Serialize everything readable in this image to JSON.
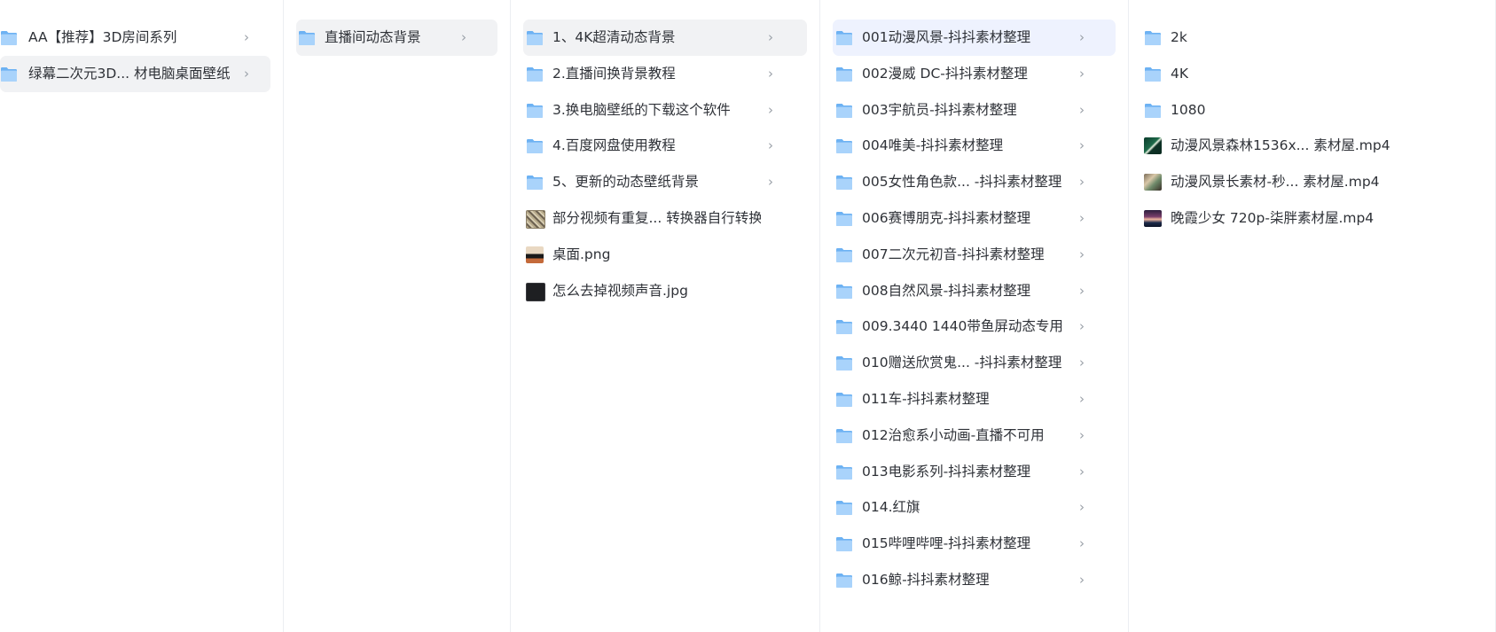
{
  "columns": [
    {
      "items": [
        {
          "label": "AA【推荐】3D房间系列",
          "type": "folder",
          "chevron": "›",
          "state": ""
        },
        {
          "label": "绿幕二次元3D... 材电脑桌面壁纸",
          "type": "folder",
          "chevron": "›",
          "state": "selected"
        }
      ]
    },
    {
      "items": [
        {
          "label": "直播间动态背景",
          "type": "folder",
          "chevron": "›",
          "state": "selected"
        }
      ]
    },
    {
      "items": [
        {
          "label": "1、4K超清动态背景",
          "type": "folder",
          "chevron": "›",
          "state": "selected"
        },
        {
          "label": "2.直播间换背景教程",
          "type": "folder",
          "chevron": "›",
          "state": ""
        },
        {
          "label": "3.换电脑壁纸的下载这个软件",
          "type": "folder",
          "chevron": "›",
          "state": ""
        },
        {
          "label": "4.百度网盘使用教程",
          "type": "folder",
          "chevron": "›",
          "state": ""
        },
        {
          "label": "5、更新的动态壁纸背景",
          "type": "folder",
          "chevron": "›",
          "state": ""
        },
        {
          "label": "部分视频有重复...  转换器自行转换",
          "type": "image",
          "thumb": "mosaic",
          "state": ""
        },
        {
          "label": "桌面.png",
          "type": "image",
          "thumb": "desk",
          "state": ""
        },
        {
          "label": "怎么去掉视频声音.jpg",
          "type": "image",
          "thumb": "dark",
          "state": ""
        }
      ]
    },
    {
      "items": [
        {
          "label": "001动漫风景-抖抖素材整理",
          "type": "folder",
          "chevron": "›",
          "state": "active"
        },
        {
          "label": "002漫威 DC-抖抖素材整理",
          "type": "folder",
          "chevron": "›",
          "state": ""
        },
        {
          "label": "003宇航员-抖抖素材整理",
          "type": "folder",
          "chevron": "›",
          "state": ""
        },
        {
          "label": "004唯美-抖抖素材整理",
          "type": "folder",
          "chevron": "›",
          "state": ""
        },
        {
          "label": "005女性角色款... -抖抖素材整理",
          "type": "folder",
          "chevron": "›",
          "state": ""
        },
        {
          "label": "006赛博朋克-抖抖素材整理",
          "type": "folder",
          "chevron": "›",
          "state": ""
        },
        {
          "label": "007二次元初音-抖抖素材整理",
          "type": "folder",
          "chevron": "›",
          "state": ""
        },
        {
          "label": "008自然风景-抖抖素材整理",
          "type": "folder",
          "chevron": "›",
          "state": ""
        },
        {
          "label": "009.3440 1440带鱼屏动态专用",
          "type": "folder",
          "chevron": "›",
          "state": ""
        },
        {
          "label": "010赠送欣赏鬼... -抖抖素材整理",
          "type": "folder",
          "chevron": "›",
          "state": ""
        },
        {
          "label": "011车-抖抖素材整理",
          "type": "folder",
          "chevron": "›",
          "state": ""
        },
        {
          "label": "012治愈系小动画-直播不可用",
          "type": "folder",
          "chevron": "›",
          "state": ""
        },
        {
          "label": "013电影系列-抖抖素材整理",
          "type": "folder",
          "chevron": "›",
          "state": ""
        },
        {
          "label": "014.红旗",
          "type": "folder",
          "chevron": "›",
          "state": ""
        },
        {
          "label": "015哔哩哔哩-抖抖素材整理",
          "type": "folder",
          "chevron": "›",
          "state": ""
        },
        {
          "label": "016鲸-抖抖素材整理",
          "type": "folder",
          "chevron": "›",
          "state": ""
        }
      ]
    },
    {
      "items": [
        {
          "label": "2k",
          "type": "folder",
          "state": ""
        },
        {
          "label": "4K",
          "type": "folder",
          "state": ""
        },
        {
          "label": "1080",
          "type": "folder",
          "state": ""
        },
        {
          "label": "动漫风景森林1536x...  素材屋.mp4",
          "type": "video",
          "thumb": "forest",
          "state": ""
        },
        {
          "label": "动漫风景长素材-秒...  素材屋.mp4",
          "type": "video",
          "thumb": "landscape",
          "state": ""
        },
        {
          "label": "晚霞少女 720p-柒胖素材屋.mp4",
          "type": "video",
          "thumb": "sunset",
          "state": ""
        }
      ]
    }
  ],
  "colors": {
    "folder_light": "#a9d3fb",
    "folder_dark": "#6db2f3",
    "selected_gray": "#f1f2f4",
    "selected_blue": "#eef2fe",
    "chevron": "#9aa0a8"
  }
}
